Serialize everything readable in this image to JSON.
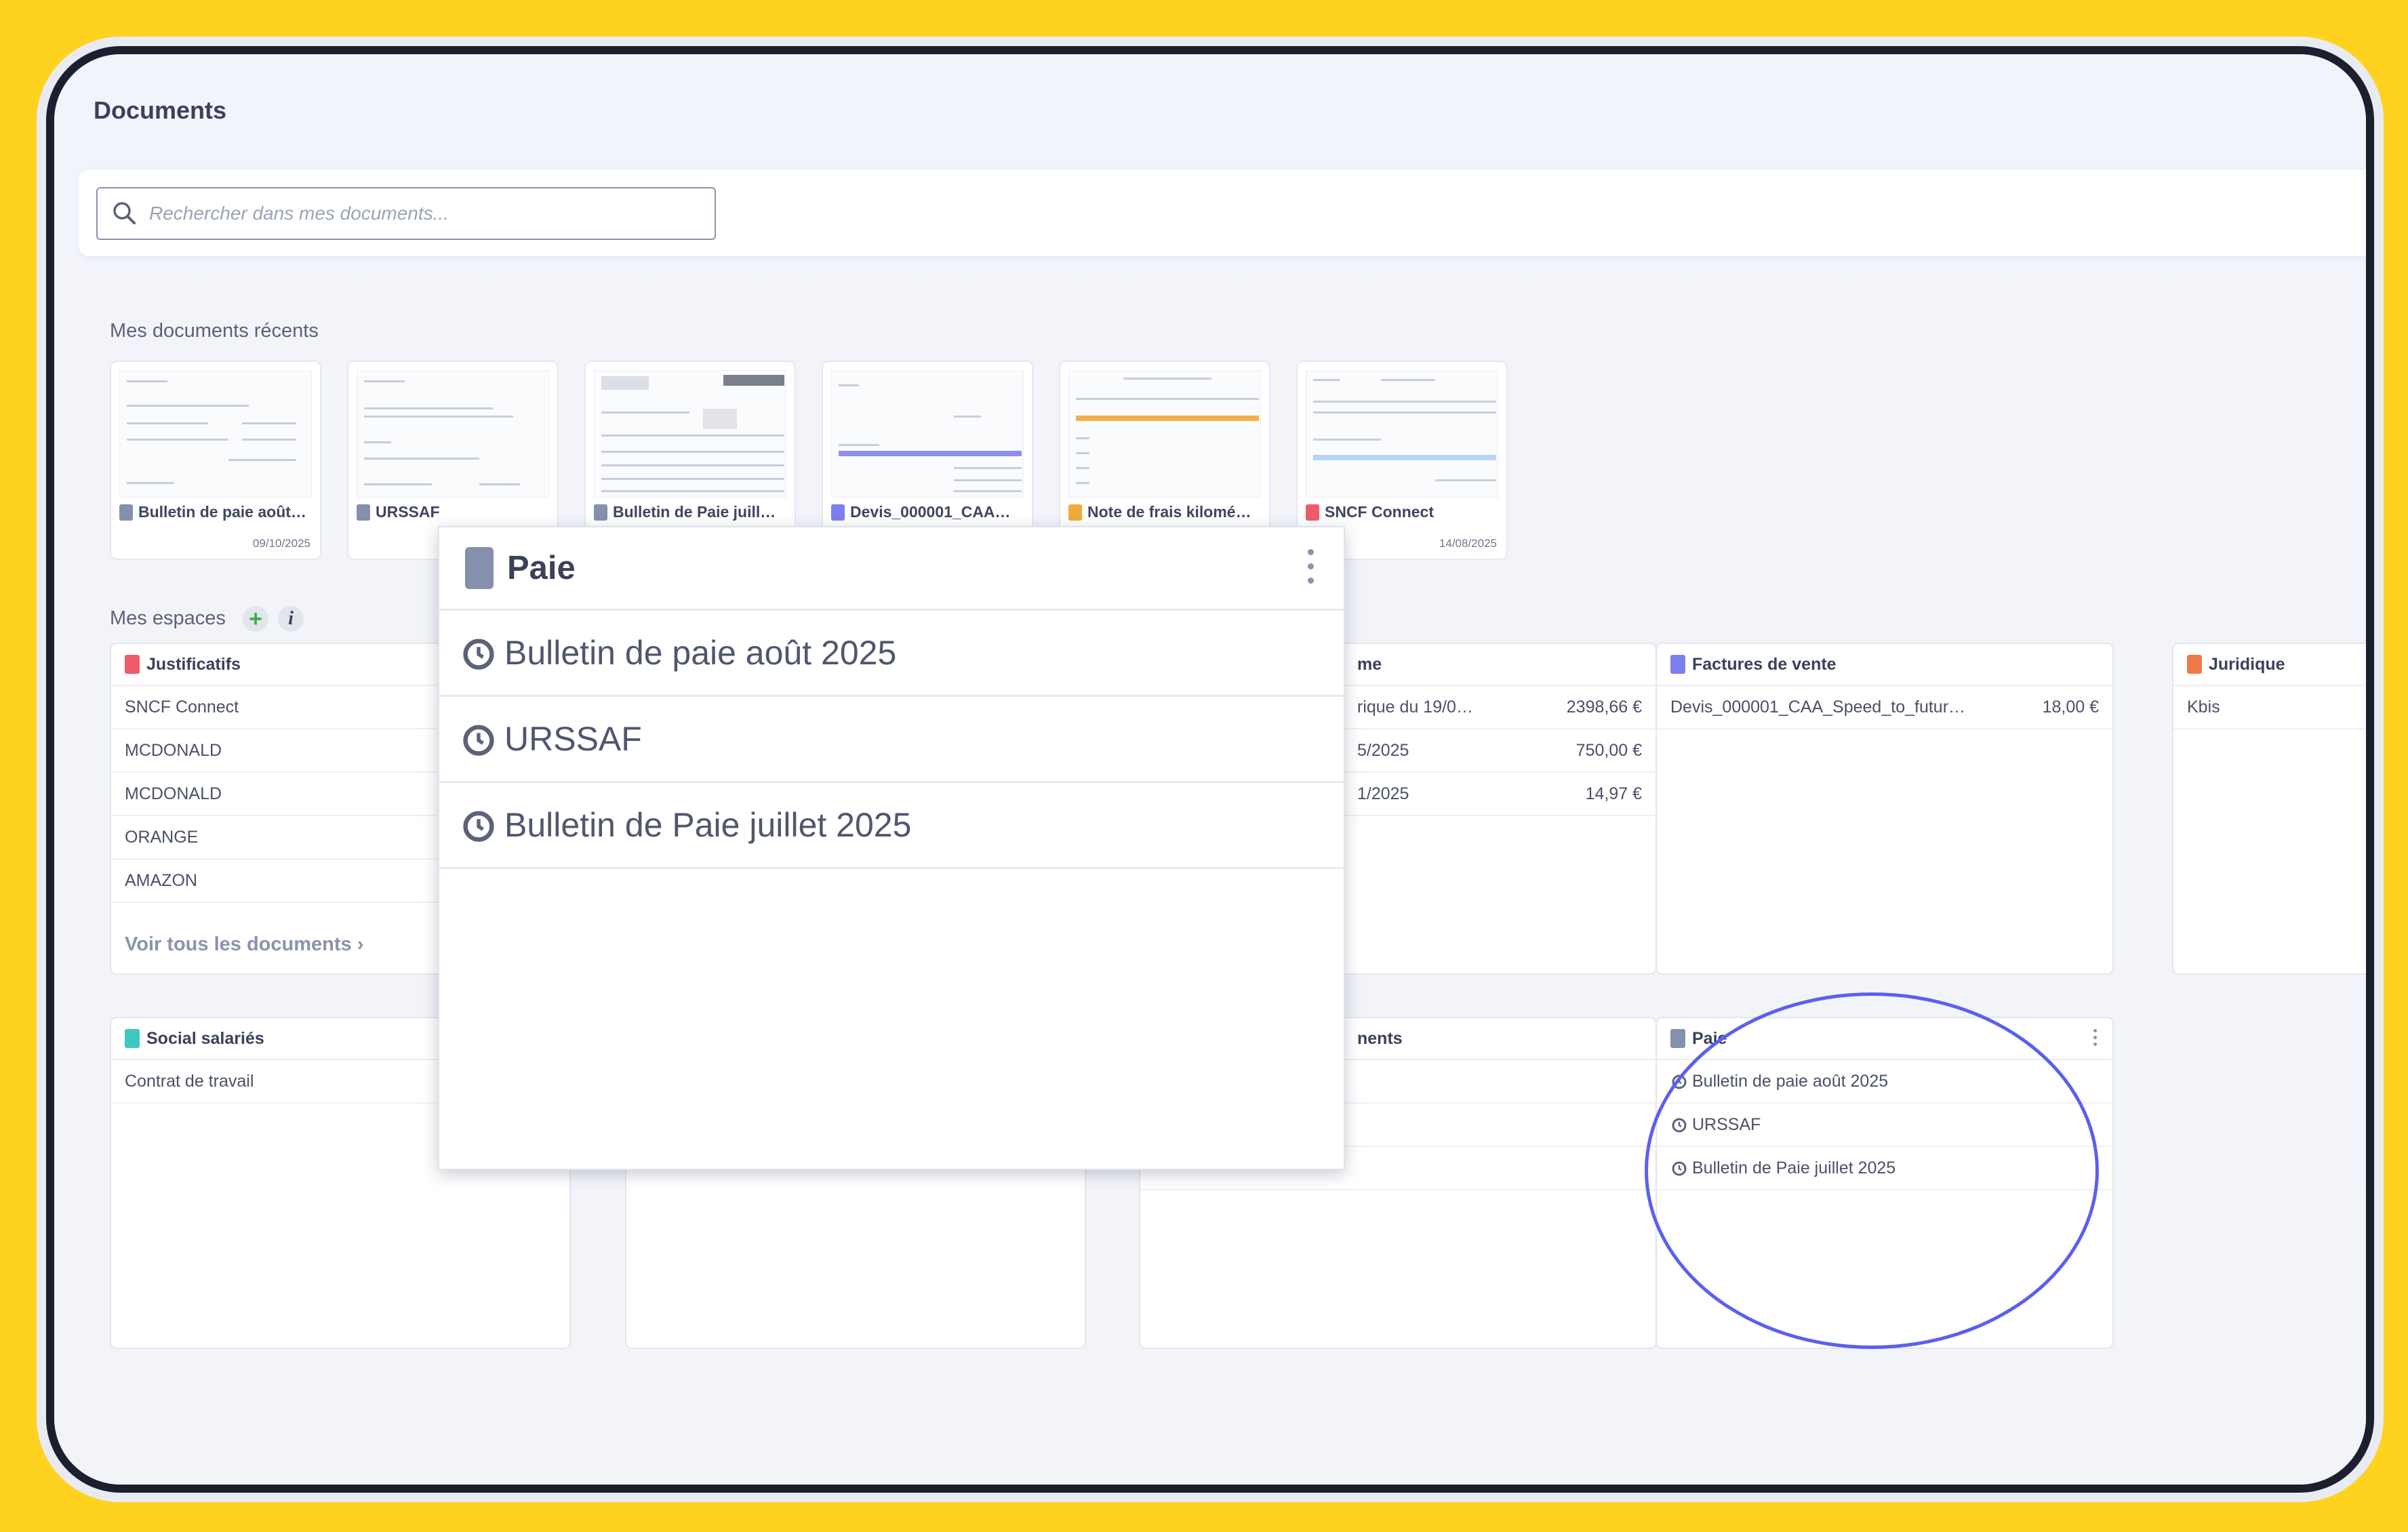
{
  "page": {
    "title": "Documents"
  },
  "search": {
    "placeholder": "Rechercher dans mes documents..."
  },
  "recent": {
    "label": "Mes documents récents",
    "items": [
      {
        "name": "Bulletin de paie août…",
        "date": "09/10/2025",
        "icon_color": "#8490ac",
        "icon": "payslip-icon"
      },
      {
        "name": "URSSAF",
        "date": "",
        "icon_color": "#8490ac",
        "icon": "payslip-icon"
      },
      {
        "name": "Bulletin de Paie juill…",
        "date": "",
        "icon_color": "#8490ac",
        "icon": "payslip-icon"
      },
      {
        "name": "Devis_000001_CAA…",
        "date": "",
        "icon_color": "#7b7ff0",
        "icon": "invoice-icon"
      },
      {
        "name": "Note de frais kilomé…",
        "date": "",
        "icon_color": "#f2a93b",
        "icon": "expense-icon"
      },
      {
        "name": "SNCF Connect",
        "date": "14/08/2025",
        "icon_color": "#ef5b6b",
        "icon": "receipt-icon"
      }
    ]
  },
  "spaces": {
    "label": "Mes espaces",
    "add_icon": "plus-icon",
    "info_icon": "info-icon",
    "justificatifs": {
      "title": "Justificatifs",
      "icon_color": "#ef5b6b",
      "rows": [
        "SNCF Connect",
        "MCDONALD",
        "MCDONALD",
        "ORANGE",
        "AMAZON"
      ],
      "see_all": "Voir tous les documents ›"
    },
    "notes": {
      "title_visible": "me",
      "rows": [
        {
          "label": "rique du 19/0…",
          "amount": "2398,66 €"
        },
        {
          "label": "5/2025",
          "amount": "750,00 €"
        },
        {
          "label": "1/2025",
          "amount": "14,97 €"
        }
      ]
    },
    "factures": {
      "title": "Factures de vente",
      "icon_color": "#7b7ff0",
      "rows": [
        {
          "label": "Devis_000001_CAA_Speed_to_futur…",
          "amount": "18,00 €"
        }
      ]
    },
    "juridique": {
      "title": "Juridique",
      "icon_color": "#f07a4a",
      "rows": [
        "Kbis"
      ]
    },
    "social": {
      "title": "Social salariés",
      "icon_color": "#3ec7c0",
      "rows": [
        "Contrat de travail"
      ]
    },
    "abonnements": {
      "title_visible": "nents"
    },
    "paie": {
      "title": "Paie",
      "icon_color": "#8490ac",
      "rows": [
        "Bulletin de paie août 2025",
        "URSSAF",
        "Bulletin de Paie juillet 2025"
      ]
    }
  },
  "zoom": {
    "title": "Paie",
    "rows": [
      "Bulletin de paie août 2025",
      "URSSAF",
      "Bulletin de Paie juillet 2025"
    ]
  },
  "colors": {
    "frame_bg": "#FFD21F",
    "accent_circle": "#5b5ff0"
  }
}
